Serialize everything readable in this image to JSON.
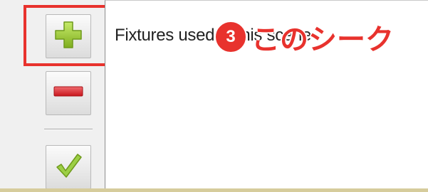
{
  "toolbar": {
    "add_icon": "plus-icon",
    "remove_icon": "minus-icon",
    "apply_icon": "checkmark-icon"
  },
  "fixture_list": {
    "header": "Fixtures used in this scene"
  },
  "annotation": {
    "step_number": "3",
    "text": "このシーク"
  },
  "colors": {
    "annotation_red": "#e8322d",
    "add_green": "#9acd32",
    "remove_red": "#d9252b",
    "apply_green": "#8cc63f"
  }
}
